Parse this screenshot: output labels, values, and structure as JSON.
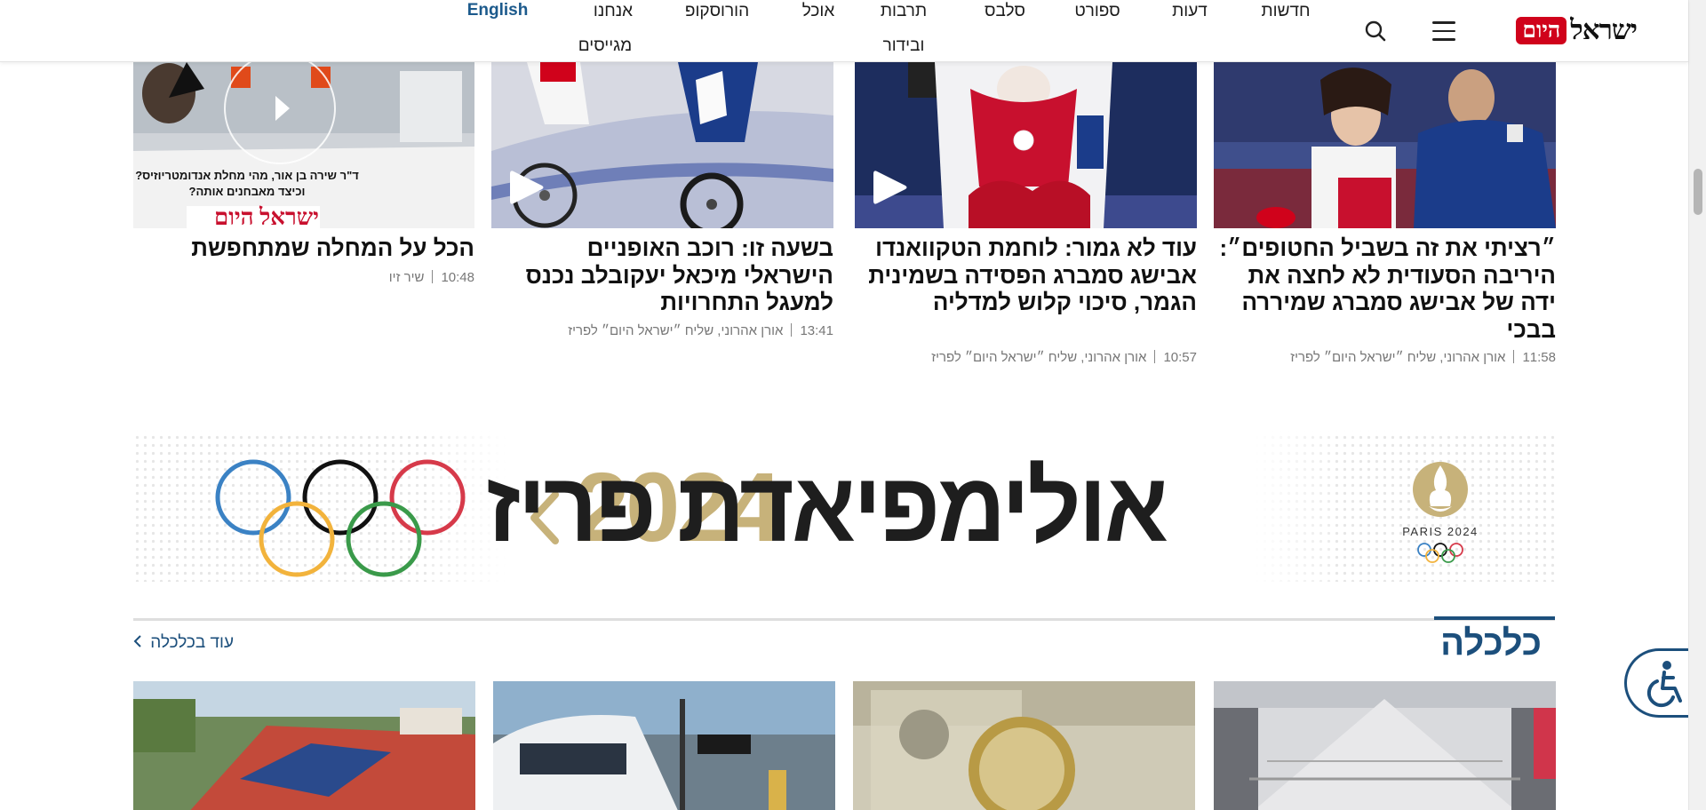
{
  "header": {
    "logo_word": "ישראל",
    "logo_badge": "היום",
    "nav": {
      "news": "חדשות",
      "opinions": "דעות",
      "sport": "ספורט",
      "celebs": "סלבס",
      "culture_line1": "תרבות",
      "culture_line2": "ובידור",
      "food": "אוכל",
      "horoscope": "הורוסקופ",
      "magazines_line1": "אנחנו",
      "magazines_line2": "מגייסים",
      "english": "English"
    }
  },
  "articles": [
    {
      "title": "״רציתי את זה בשביל החטופים״: היריבה הסעודית לא לחצה את ידה של אבישג סמברג שמיררה בבכי",
      "time": "11:58",
      "author": "אורן אהרוני, שליח ״ישראל היום״ לפריז"
    },
    {
      "title": "עוד לא גמור: לוחמת הטקוואנדו אבישג סמברג הפסידה בשמינית הגמר, סיכוי קלוש למדליה",
      "time": "10:57",
      "author": "אורן אהרוני, שליח ״ישראל היום״ לפריז"
    },
    {
      "title": "בשעה זו: רוכב האופניים הישראלי מיכאל יעקובלב נכנס למעגל התחרויות",
      "time": "13:41",
      "author": "אורן אהרוני, שליח ״ישראל היום״ לפריז"
    },
    {
      "title": "הכל על המחלה שמתחפשת",
      "time": "10:48",
      "author": "שיר זיו",
      "video_caption_line1": "ד\"ר שירה בן אור, מהי מחלת אנדומטריוזיס?",
      "video_caption_line2": "וכיצד מאבחנים אותה?",
      "video_logo": "ישראל היום"
    }
  ],
  "banner": {
    "title": "אולימפיאדת פריז",
    "year": "2024",
    "paris_label": "PARIS 2024"
  },
  "section": {
    "title": "כלכלה",
    "more_link": "עוד בכלכלה"
  },
  "icons": {
    "search": "search-icon",
    "menu": "hamburger-menu-icon",
    "accessibility": "accessibility-wheelchair-icon",
    "play": "play-icon",
    "chevron": "chevron-left-icon"
  },
  "colors": {
    "brand_red": "#d0021b",
    "section_blue": "#1c4f7c",
    "olympic_gold": "#c7b27a"
  }
}
